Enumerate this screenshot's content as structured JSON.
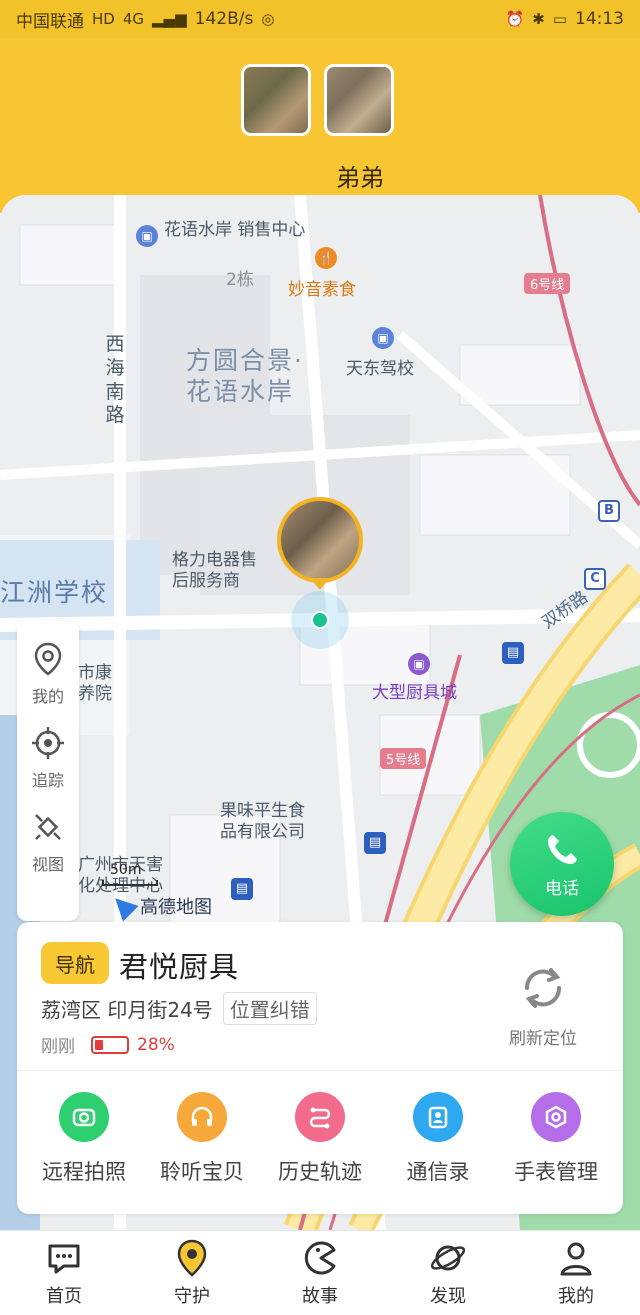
{
  "status_bar": {
    "carrier": "中国联通",
    "network": "4G",
    "speed": "142B/s",
    "time": "14:13"
  },
  "header": {
    "child_name": "弟弟",
    "accent_color": "#f7c632"
  },
  "map": {
    "labels": {
      "flower_water_sales": "花语水岸\n销售中心",
      "building2": "2栋",
      "miaoyin": "妙音素食",
      "tiandong": "天东驾校",
      "fangyuan": "方圆合景·\n花语水岸",
      "xihai": "西海南路",
      "geli": "格力电器售\n后服务商",
      "jiangzhou": "江洲学校",
      "shikang": "市康\n养院",
      "kitchen_city": "大型厨具城",
      "guowei": "果味平生食\n品有限公司",
      "guangzhou": "广州市天害\n化处理中心",
      "shuangqiao": "双桥路",
      "line6": "6号线",
      "line5": "5号线",
      "b_station": "B",
      "c_station": "C"
    },
    "scale": "50m",
    "provider": "高德地图"
  },
  "side_tools": [
    {
      "label": "我的"
    },
    {
      "label": "追踪"
    },
    {
      "label": "视图"
    }
  ],
  "call_button": {
    "label": "电话"
  },
  "info_card": {
    "nav_label": "导航",
    "place_name": "君悦厨具",
    "address": "荔湾区 印月街24号",
    "correct_label": "位置纠错",
    "updated": "刚刚",
    "battery_percent": 28,
    "battery_text": "28%",
    "refresh_label": "刷新定位"
  },
  "features": [
    {
      "label": "远程拍照",
      "icon": "camera-icon",
      "color": "#2ecf6f"
    },
    {
      "label": "聆听宝贝",
      "icon": "headphones-icon",
      "color": "#f7a83a"
    },
    {
      "label": "历史轨迹",
      "icon": "route-icon",
      "color": "#f26b8a"
    },
    {
      "label": "通信录",
      "icon": "contacts-icon",
      "color": "#2ea8f0"
    },
    {
      "label": "手表管理",
      "icon": "watch-settings-icon",
      "color": "#b46ee8"
    }
  ],
  "bottom_nav": [
    {
      "label": "首页"
    },
    {
      "label": "守护"
    },
    {
      "label": "故事"
    },
    {
      "label": "发现"
    },
    {
      "label": "我的"
    }
  ]
}
